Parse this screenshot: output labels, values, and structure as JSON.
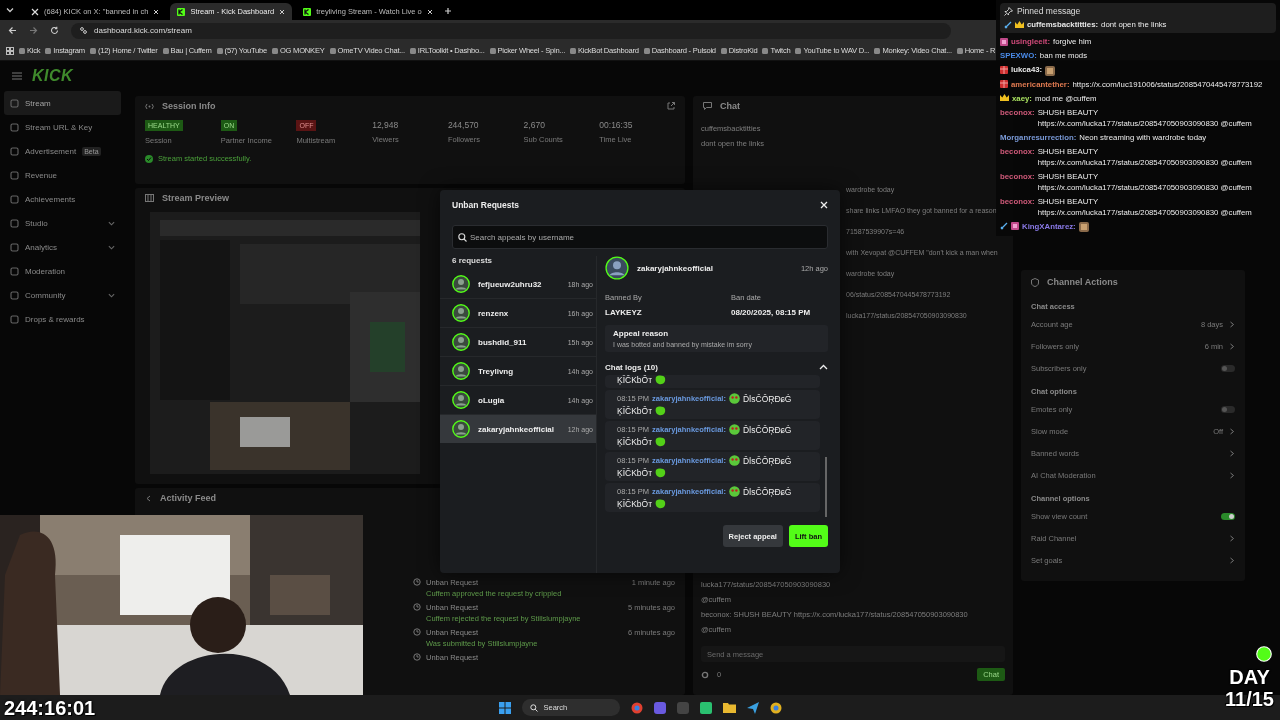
{
  "browser": {
    "tabs": [
      {
        "title": "(684) KICK on X: \"banned in ch",
        "kind": "x",
        "selected": false
      },
      {
        "title": "Stream - Kick Dashboard",
        "kind": "kick",
        "selected": true
      },
      {
        "title": "treyliving Stream - Watch Live o",
        "kind": "kick",
        "selected": false
      }
    ],
    "url": "dashboard.kick.com/stream",
    "bookmarks": [
      "Kick",
      "Instagram",
      "(12) Home / Twitter",
      "Bau | Cuffem",
      "(57) YouTube",
      "OG MONKEY",
      "OmeTV Video Chat...",
      "IRLToolkit • Dashbo...",
      "Picker Wheel - Spin...",
      "KickBot Dashboard",
      "Dashboard - Pulsoid",
      "DistroKid",
      "Twitch",
      "YouTube to WAV D...",
      "Monkey: Video Chat...",
      "Home - R"
    ]
  },
  "dashboard": {
    "logo": "KICK",
    "sidebar": [
      {
        "label": "Stream",
        "selected": true,
        "expandable": false
      },
      {
        "label": "Stream URL & Key",
        "selected": false,
        "expandable": false
      },
      {
        "label": "Advertisement",
        "badge": "Beta",
        "selected": false,
        "expandable": false
      },
      {
        "label": "Revenue",
        "selected": false,
        "expandable": false
      },
      {
        "label": "Achievements",
        "selected": false,
        "expandable": false
      },
      {
        "label": "Studio",
        "selected": false,
        "expandable": true
      },
      {
        "label": "Analytics",
        "selected": false,
        "expandable": true
      },
      {
        "label": "Moderation",
        "selected": false,
        "expandable": false
      },
      {
        "label": "Community",
        "selected": false,
        "expandable": true
      },
      {
        "label": "Drops & rewards",
        "selected": false,
        "expandable": false
      }
    ],
    "session_info": {
      "title": "Session Info",
      "statuses": [
        {
          "value": "HEALTHY",
          "label": "Session",
          "kind": "ok"
        },
        {
          "value": "ON",
          "label": "Partner Income",
          "kind": "ok"
        },
        {
          "value": "OFF",
          "label": "Multistream",
          "kind": "off"
        }
      ],
      "stats": [
        {
          "value": "12,948",
          "label": "Viewers"
        },
        {
          "value": "244,570",
          "label": "Followers"
        },
        {
          "value": "2,670",
          "label": "Sub Counts"
        },
        {
          "value": "00:16:35",
          "label": "Time Live"
        }
      ],
      "notice": "Stream started successfully."
    },
    "stream_preview": {
      "title": "Stream Preview"
    },
    "activity_feed": {
      "title": "Activity Feed",
      "items": [
        {
          "title": "Unban Request",
          "detail": "Cuffem approved the request by crippled",
          "time": "1 minute ago"
        },
        {
          "title": "Unban Request",
          "detail": "Cuffem rejected the request by Stillslumpjayne",
          "time": "5 minutes ago"
        },
        {
          "title": "Unban Request",
          "detail": "Was submitted by Stillslumpjayne",
          "time": "6 minutes ago"
        },
        {
          "title": "Unban Request"
        }
      ]
    },
    "chat": {
      "title": "Chat",
      "lines": [
        {
          "kind": "top",
          "text": "cuffemsbacktitties"
        },
        {
          "kind": "top",
          "text": "dont open the links"
        },
        {
          "kind": "side",
          "text": "wardrobe today"
        },
        {
          "kind": "side",
          "text": "share links LMFAO they got banned for a reason"
        },
        {
          "kind": "side",
          "text": "71587539907s=46"
        },
        {
          "kind": "side",
          "text": "with Xevopat @CUFFEM \"don't kick a man when"
        },
        {
          "kind": "side",
          "text": "wardrobe today"
        },
        {
          "kind": "side",
          "text": "06/status/2085470445478773192"
        },
        {
          "kind": "side",
          "text": "lucka177/status/208547050903090830"
        },
        {
          "kind": "full",
          "text": "lucka177/status/208547050903090830"
        },
        {
          "kind": "full",
          "text": "@cuffem"
        },
        {
          "kind": "full",
          "text": "beconox: SHUSH BEAUTY https://x.com/lucka177/status/208547050903090830"
        },
        {
          "kind": "full",
          "text": "@cuffem"
        }
      ],
      "input_placeholder": "Send a message",
      "count": "0",
      "send": "Chat"
    },
    "channel_actions": {
      "title": "Channel Actions",
      "items": [
        {
          "kind": "heading",
          "label": "Chat access"
        },
        {
          "kind": "link",
          "label": "Account age",
          "value": "8 days"
        },
        {
          "kind": "link",
          "label": "Followers only",
          "value": "6 min"
        },
        {
          "kind": "toggle",
          "label": "Subscribers only",
          "on": false
        },
        {
          "kind": "heading",
          "label": "Chat options"
        },
        {
          "kind": "toggle",
          "label": "Emotes only",
          "on": false
        },
        {
          "kind": "link",
          "label": "Slow mode",
          "value": "Off"
        },
        {
          "kind": "link",
          "label": "Banned words"
        },
        {
          "kind": "link",
          "label": "AI Chat Moderation"
        },
        {
          "kind": "heading",
          "label": "Channel options"
        },
        {
          "kind": "toggle",
          "label": "Show view count",
          "on": true
        },
        {
          "kind": "link",
          "label": "Raid Channel"
        },
        {
          "kind": "link",
          "label": "Set goals"
        }
      ]
    }
  },
  "modal": {
    "title": "Unban Requests",
    "search_placeholder": "Search appeals by username",
    "count": "6 requests",
    "requests": [
      {
        "name": "fefjueuw2uhru32",
        "time": "18h ago",
        "selected": false
      },
      {
        "name": "renzenx",
        "time": "16h ago",
        "selected": false
      },
      {
        "name": "bushdid_911",
        "time": "15h ago",
        "selected": false
      },
      {
        "name": "Treylivng",
        "time": "14h ago",
        "selected": false
      },
      {
        "name": "oLugia",
        "time": "14h ago",
        "selected": false
      },
      {
        "name": "zakaryjahnkeofficial",
        "time": "12h ago",
        "selected": true
      }
    ],
    "detail": {
      "name": "zakaryjahnkeofficial",
      "time": "12h ago",
      "banned_by_label": "Banned By",
      "banned_by": "LAYKEYZ",
      "ban_date_label": "Ban date",
      "ban_date": "08/20/2025, 08:15 PM",
      "appeal_title": "Appeal reason",
      "appeal_text": "I was botted and banned by mistake im sorry"
    },
    "chat_logs": {
      "title": "Chat logs (10)",
      "expanded": true,
      "logs": [
        {
          "kind": "cut",
          "tail": "ĶĪĈKbÔт"
        },
        {
          "kind": "full",
          "time": "08:15 PM",
          "user": "zakaryjahnkeofficial:",
          "text": "ĎǀsĈÔŖĐɕĠ",
          "tail": "ĶĪĈKbÔт"
        },
        {
          "kind": "full",
          "time": "08:15 PM",
          "user": "zakaryjahnkeofficial:",
          "text": "ĎǀsĈÔŖĐɕĠ",
          "tail": "ĶĪĈKbÔт"
        },
        {
          "kind": "full",
          "time": "08:15 PM",
          "user": "zakaryjahnkeofficial:",
          "text": "ĎǀsĈÔŖĐɕĠ",
          "tail": "ĶĪĈKbÔт"
        },
        {
          "kind": "full",
          "time": "08:15 PM",
          "user": "zakaryjahnkeofficial:",
          "text": "ĎǀsĈÔŖĐɕĠ",
          "tail": "ĶĪĈKbÔт"
        }
      ]
    },
    "reject": "Reject appeal",
    "lift": "Lift ban"
  },
  "chat_overlay": {
    "pinned": {
      "title": "Pinned message",
      "moderator": true,
      "crown": true,
      "author": "cuffemsbacktitties:",
      "text": "dont open the links"
    },
    "messages": [
      {
        "subscriber": true,
        "author": "usingleeit:",
        "color": "#d04a7a",
        "text": "forgive him"
      },
      {
        "author": "SPEXWO:",
        "color": "#4a8ae8",
        "text": "ban me mods"
      },
      {
        "gifter": true,
        "author": "lukca43:",
        "color": "#e8e8e8",
        "emote": true
      },
      {
        "gifter": true,
        "author": "americantether:",
        "color": "#e07a50",
        "text": "https://x.com/luc191006/status/2085470445478773192"
      },
      {
        "crown": true,
        "author": "xaey:",
        "color": "#a8e060",
        "text": "mod me @cuffem"
      },
      {
        "author": "beconox:",
        "color": "#d05a7a",
        "text": "SHUSH BEAUTY https://x.com/lucka177/status/208547050903090830 @cuffem"
      },
      {
        "author": "Morganresurrection:",
        "color": "#7a9ad8",
        "text": "Neon streaming with wardrobe today"
      },
      {
        "author": "beconox:",
        "color": "#d05a7a",
        "text": "SHUSH BEAUTY https://x.com/lucka177/status/208547050903090830 @cuffem"
      },
      {
        "author": "beconox:",
        "color": "#d05a7a",
        "text": "SHUSH BEAUTY https://x.com/lucka177/status/208547050903090830 @cuffem"
      },
      {
        "author": "beconox:",
        "color": "#d05a7a",
        "text": "SHUSH BEAUTY https://x.com/lucka177/status/208547050903090830 @cuffem"
      },
      {
        "moderator": true,
        "subscriber": true,
        "author": "KingXAntarez:",
        "color": "#8a7ae8",
        "emote": true
      }
    ]
  },
  "webcam": {
    "timer": "244:16:01"
  },
  "day_counter": {
    "label": "DAY",
    "count": "11/15"
  },
  "taskbar": {
    "search": "Search"
  }
}
